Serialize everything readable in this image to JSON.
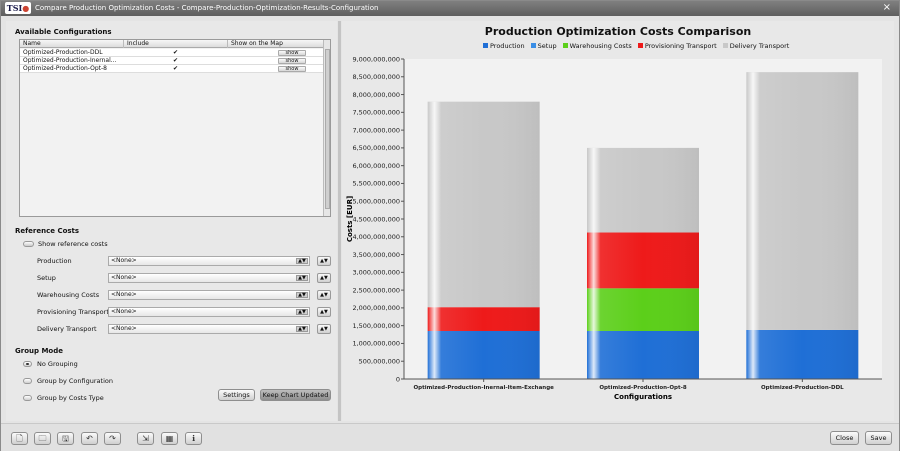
{
  "window": {
    "title": "Compare Production Optimization Costs - Compare-Production-Optimization-Results-Configuration",
    "logo": "TSI",
    "close": "×"
  },
  "configs": {
    "title": "Available Configurations",
    "columns": [
      "Name",
      "Include",
      "Show on the Map"
    ],
    "rows": [
      {
        "name": "Optimized-Production-DDL",
        "include": "✔",
        "show": "show"
      },
      {
        "name": "Optimized-Production-Inernal...",
        "include": "✔",
        "show": "show"
      },
      {
        "name": "Optimized-Production-Opt-8",
        "include": "✔",
        "show": "show"
      }
    ]
  },
  "reference": {
    "title": "Reference Costs",
    "show_label": "Show reference costs",
    "combo_arrow": "▲▼",
    "items": [
      {
        "label": "Production",
        "value": "<None>"
      },
      {
        "label": "Setup",
        "value": "<None>"
      },
      {
        "label": "Warehousing Costs",
        "value": "<None>"
      },
      {
        "label": "Provisioning Transport",
        "value": "<None>"
      },
      {
        "label": "Delivery Transport",
        "value": "<None>"
      }
    ]
  },
  "group_mode": {
    "title": "Group Mode",
    "options": [
      {
        "label": "No Grouping",
        "selected": true
      },
      {
        "label": "Group by Configuration",
        "selected": false
      },
      {
        "label": "Group by Costs Type",
        "selected": false
      }
    ],
    "settings_label": "Settings",
    "keep_updated_label": "Keep Chart Updated"
  },
  "footer": {
    "close_label": "Close",
    "save_label": "Save"
  },
  "chart_data": {
    "type": "bar",
    "stacked": true,
    "title": "Production Optimization Costs Comparison",
    "xlabel": "Configurations",
    "ylabel": "Costs [EUR]",
    "ylim": [
      0,
      9000000000
    ],
    "ytick_step": 500000000,
    "yticks": [
      "0",
      "500,000,000",
      "1,000,000,000",
      "1,500,000,000",
      "2,000,000,000",
      "2,500,000,000",
      "3,000,000,000",
      "3,500,000,000",
      "4,000,000,000",
      "4,500,000,000",
      "5,000,000,000",
      "5,500,000,000",
      "6,000,000,000",
      "6,500,000,000",
      "7,000,000,000",
      "7,500,000,000",
      "8,000,000,000",
      "8,500,000,000",
      "9,000,000,000"
    ],
    "categories": [
      "Optimized-Production-Inernal-Item-Exchange",
      "Optimized-Production-Opt-8",
      "Optimized-Production-DDL"
    ],
    "series": [
      {
        "name": "Production",
        "color": "#1f6fd6",
        "values": [
          1350000000,
          1350000000,
          1380000000
        ]
      },
      {
        "name": "Setup",
        "color": "#3a8ee6",
        "values": [
          0,
          0,
          0
        ]
      },
      {
        "name": "Warehousing Costs",
        "color": "#5ccf1a",
        "values": [
          0,
          1200000000,
          0
        ]
      },
      {
        "name": "Provisioning Transport",
        "color": "#ee1a1a",
        "values": [
          670000000,
          1570000000,
          0
        ]
      },
      {
        "name": "Delivery Transport",
        "color": "#c8c8c8",
        "values": [
          5780000000,
          2380000000,
          7250000000
        ]
      }
    ],
    "legend_position": "top",
    "grid": false
  }
}
